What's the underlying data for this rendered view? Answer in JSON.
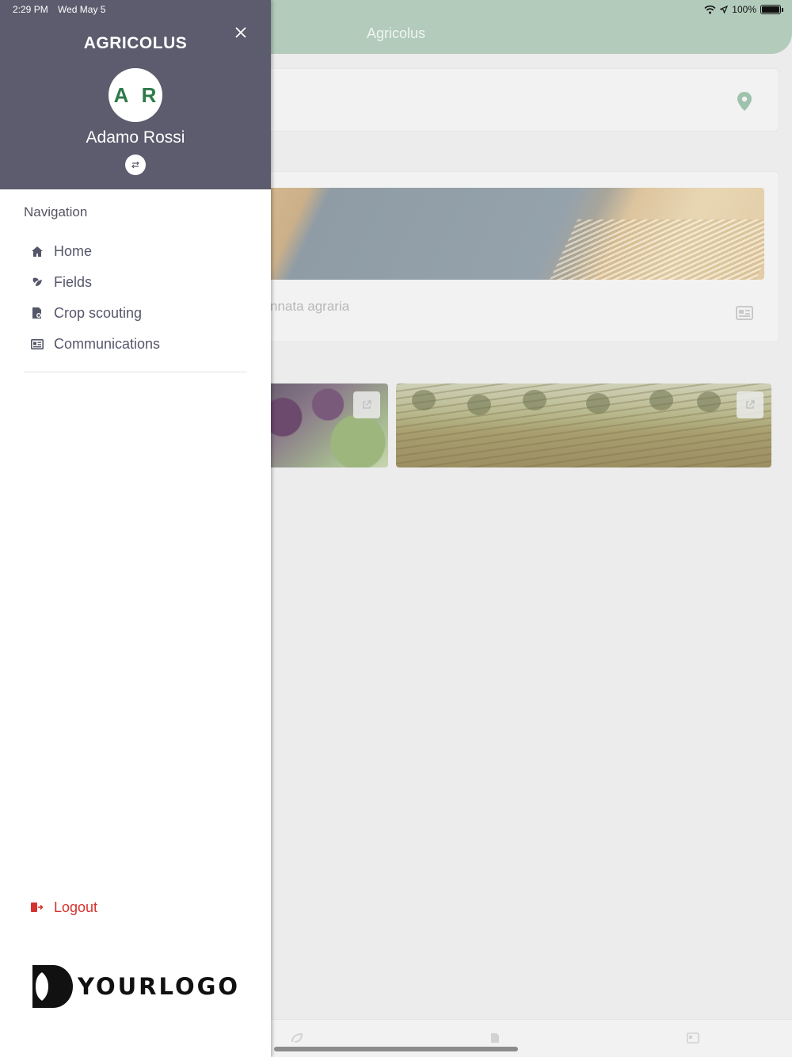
{
  "status_bar": {
    "time": "2:29 PM",
    "date": "Wed May 5",
    "battery_percent": "100%",
    "battery_level": 1.0
  },
  "app": {
    "title": "Agricolus",
    "news_caption": "nnata agraria"
  },
  "drawer": {
    "brand": "AGRICOLUS",
    "avatar_initials": "A R",
    "user_name": "Adamo Rossi",
    "nav_heading": "Navigation",
    "items": [
      {
        "label": "Home",
        "icon": "home-icon"
      },
      {
        "label": "Fields",
        "icon": "leaf-icon"
      },
      {
        "label": "Crop scouting",
        "icon": "scouting-icon"
      },
      {
        "label": "Communications",
        "icon": "newspaper-icon"
      }
    ],
    "logout_label": "Logout",
    "logo_text": "YOURLOGO"
  },
  "colors": {
    "drawer_header": "#5c5c6e",
    "app_header": "#b3cbbb",
    "avatar_text": "#2e7a49",
    "logout": "#d4322e",
    "nav_text": "#55566a"
  }
}
